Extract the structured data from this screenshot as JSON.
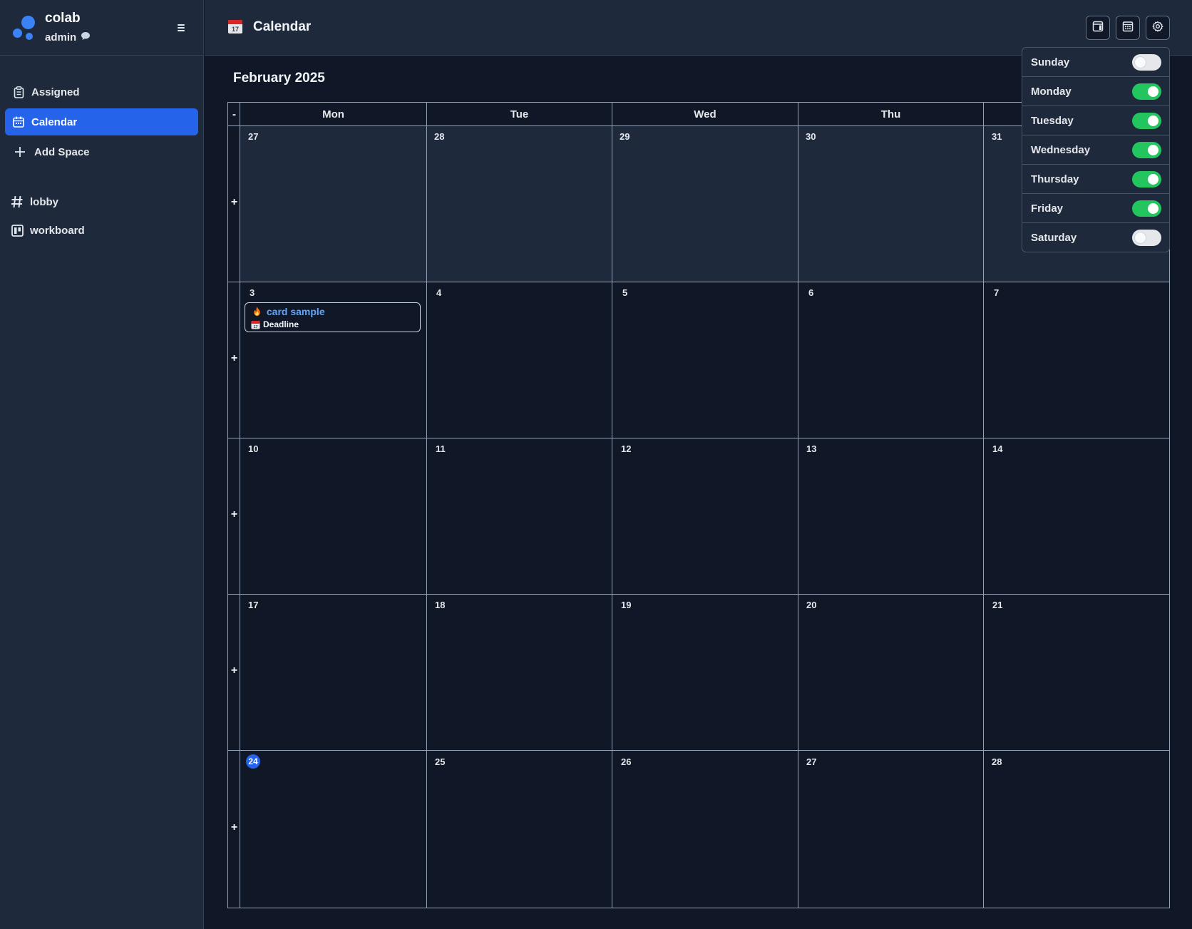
{
  "sidebar": {
    "brand_name": "colab",
    "user": "admin",
    "chat_icon": "chat-bubble-icon",
    "menu_icon": "menu-icon",
    "nav": [
      {
        "label": "Assigned",
        "icon": "clipboard-icon"
      },
      {
        "label": "Calendar",
        "icon": "calendar-icon",
        "active": true
      },
      {
        "label": "Add Space",
        "icon": "plus-icon"
      }
    ],
    "spaces": [
      {
        "label": "lobby",
        "icon": "hash-icon"
      },
      {
        "label": "workboard",
        "icon": "board-icon"
      }
    ]
  },
  "header": {
    "title": "Calendar",
    "buttons": [
      "window-icon",
      "calendar-grid-icon",
      "gear-icon"
    ]
  },
  "calendar": {
    "month_title": "February 2025",
    "collapse_label": "-",
    "add_label": "+",
    "weekdays": [
      "Mon",
      "Tue",
      "Wed",
      "Thu"
    ],
    "weeks": [
      [
        "27",
        "28",
        "29",
        "30",
        "31"
      ],
      [
        "3",
        "4",
        "5",
        "6",
        "7"
      ],
      [
        "10",
        "11",
        "12",
        "13",
        "14"
      ],
      [
        "17",
        "18",
        "19",
        "20",
        "21"
      ],
      [
        "24",
        "25",
        "26",
        "27",
        "28"
      ]
    ],
    "today": "24",
    "card": {
      "title": "card sample",
      "title_icon": "fire-icon",
      "subtitle": "Deadline",
      "subtitle_icon": "calendar-emoji-icon"
    }
  },
  "popover": {
    "days": [
      {
        "label": "Sunday",
        "enabled": false
      },
      {
        "label": "Monday",
        "enabled": true
      },
      {
        "label": "Tuesday",
        "enabled": true
      },
      {
        "label": "Wednesday",
        "enabled": true
      },
      {
        "label": "Thursday",
        "enabled": true
      },
      {
        "label": "Friday",
        "enabled": true
      },
      {
        "label": "Saturday",
        "enabled": false
      }
    ]
  },
  "colors": {
    "accent": "#2563eb",
    "toggle_on": "#22c55e",
    "link": "#60a5fa"
  }
}
